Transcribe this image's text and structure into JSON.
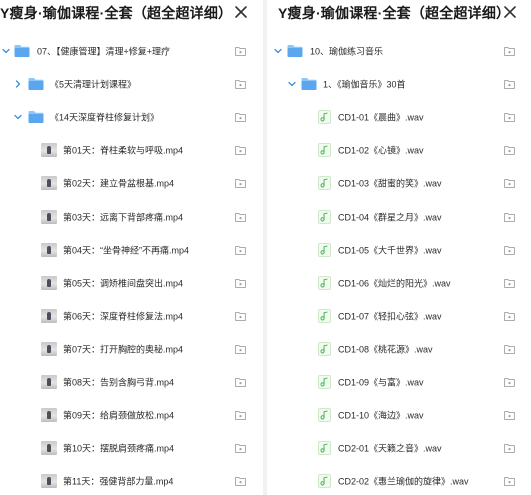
{
  "left": {
    "title": "Y瘦身·瑜伽课程·全套（超全超详细）",
    "rows": [
      {
        "type": "folder",
        "label": "07、【健康管理】清理+修复+理疗",
        "expanded": true
      },
      {
        "type": "folder",
        "label": "《5天清理计划课程》",
        "expanded": false
      },
      {
        "type": "folder",
        "label": "《14天深度脊柱修复计划》",
        "expanded": true
      },
      {
        "type": "video",
        "label": "第01天：脊柱柔软与呼吸.mp4"
      },
      {
        "type": "video",
        "label": "第02天：建立骨盆根基.mp4"
      },
      {
        "type": "video",
        "label": "第03天：远离下背部疼痛.mp4"
      },
      {
        "type": "video",
        "label": "第04天：“坐骨神经”不再痛.mp4"
      },
      {
        "type": "video",
        "label": "第05天：调矫椎间盘突出.mp4"
      },
      {
        "type": "video",
        "label": "第06天：深度脊柱修复法.mp4"
      },
      {
        "type": "video",
        "label": "第07天：打开胸腔的奥秘.mp4"
      },
      {
        "type": "video",
        "label": "第08天：告别含胸弓背.mp4"
      },
      {
        "type": "video",
        "label": "第09天：给肩颈做放松.mp4"
      },
      {
        "type": "video",
        "label": "第10天：摆脱肩颈疼痛.mp4"
      },
      {
        "type": "video",
        "label": "第11天：强健背部力量.mp4"
      }
    ]
  },
  "right": {
    "title": "Y瘦身·瑜伽课程·全套（超全超详细）",
    "rows": [
      {
        "type": "folder",
        "label": "10、瑜伽练习音乐",
        "expanded": true
      },
      {
        "type": "folder",
        "label": "1、《瑜伽音乐》30首",
        "expanded": true
      },
      {
        "type": "audio",
        "label": "CD1-01《晨曲》.wav"
      },
      {
        "type": "audio",
        "label": "CD1-02《心镜》.wav"
      },
      {
        "type": "audio",
        "label": "CD1-03《甜蜜的笑》.wav"
      },
      {
        "type": "audio",
        "label": "CD1-04《群星之月》.wav"
      },
      {
        "type": "audio",
        "label": "CD1-05《大千世界》.wav"
      },
      {
        "type": "audio",
        "label": "CD1-06《灿烂的阳光》.wav"
      },
      {
        "type": "audio",
        "label": "CD1-07《轻扣心弦》.wav"
      },
      {
        "type": "audio",
        "label": "CD1-08《桃花源》.wav"
      },
      {
        "type": "audio",
        "label": "CD1-09《与富》.wav"
      },
      {
        "type": "audio",
        "label": "CD1-10《海边》.wav"
      },
      {
        "type": "audio",
        "label": "CD2-01《天籁之音》.wav"
      },
      {
        "type": "audio",
        "label": "CD2-02《惠兰瑜伽的旋律》.wav"
      }
    ]
  },
  "icons": {
    "close": "close-icon",
    "chevron_down": "chevron-down-icon",
    "chevron_right": "chevron-right-icon",
    "folder": "folder-icon",
    "video_thumbnail": "video-thumbnail-icon",
    "audio_file": "audio-file-icon",
    "folder_action": "folder-action-icon"
  },
  "colors": {
    "folder_blue": "#5aa7f0",
    "folder_tab": "#8cc6fb",
    "chevron": "#3d8fe0",
    "audio_green": "#3fb24f",
    "action_gray": "#a0a0a0",
    "divider": "#f2f2f2"
  }
}
